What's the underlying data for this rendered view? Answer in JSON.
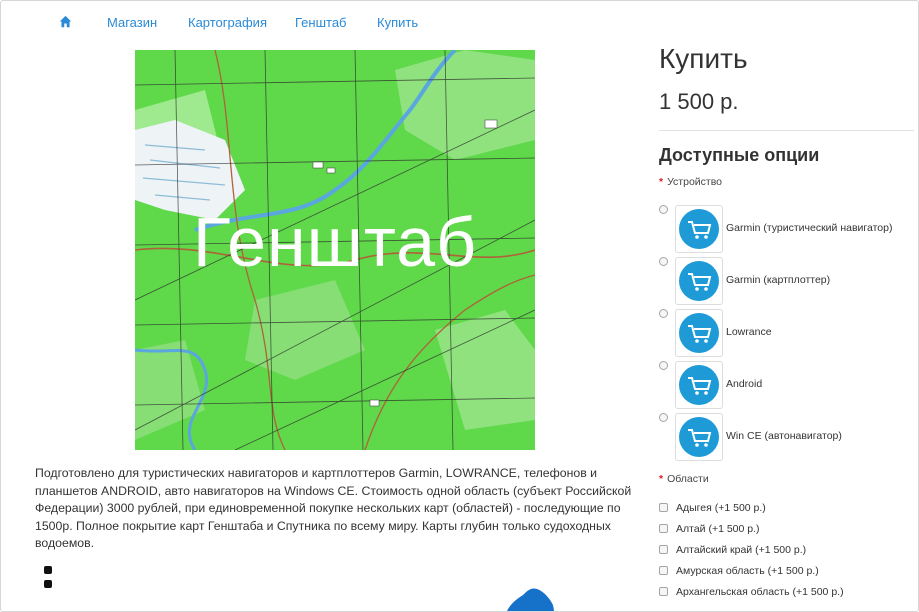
{
  "breadcrumb": {
    "home_icon": "home-icon",
    "items": [
      "Магазин",
      "Картография",
      "Генштаб",
      "Купить"
    ]
  },
  "image": {
    "overlay_text": "Генштаб",
    "colors": {
      "forest": "#5fd84a",
      "grid": "#2a2a2a",
      "water": "#5aa6df",
      "road": "#b0623a"
    }
  },
  "description": "Подготовлено для туристических навигаторов и картплоттеров Garmin, LOWRANCE, телефонов и планшетов ANDROID, авто навигаторов на Windows CE. Стоимость одной область (субъект Российской Федерации) 3000 рублей, при единовременной покупке нескольких карт (областей) - последующие по 1500р. Полное покрытие карт Генштаба и Спутника по всему миру. Карты глубин только судоходных водоемов.",
  "product": {
    "title": "Купить",
    "price": "1 500 р."
  },
  "options": {
    "title": "Доступные опции",
    "device": {
      "label": "Устройство",
      "items": [
        "Garmin (туристический навигатор)",
        "Garmin (картплоттер)",
        "Lowrance",
        "Android",
        "Win CE (автонавигатор)"
      ]
    },
    "regions": {
      "label": "Области",
      "items": [
        "Адыгея (+1 500 р.)",
        "Алтай (+1 500 р.)",
        "Алтайский край (+1 500 р.)",
        "Амурская область (+1 500 р.)",
        "Архангельская область (+1 500 р.)"
      ]
    }
  },
  "accent_color": "#2a8ad6",
  "required_color": "#e02020"
}
